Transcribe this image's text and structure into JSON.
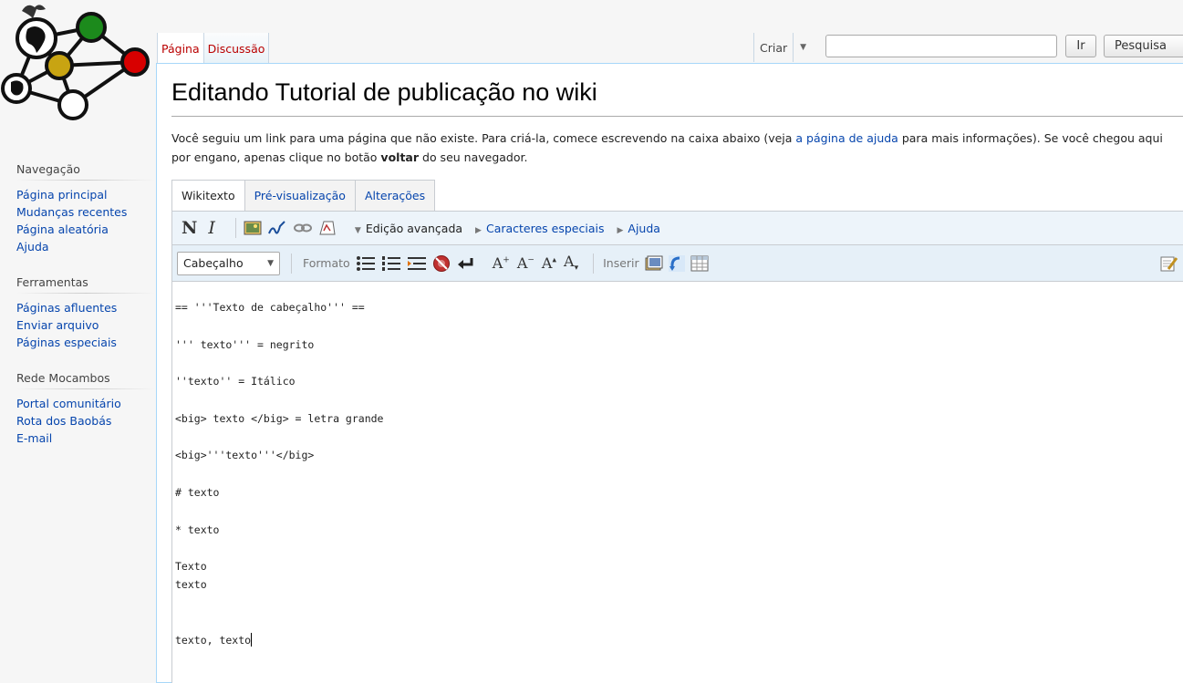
{
  "nav_tabs": {
    "page": "Página",
    "discussion": "Discussão",
    "create": "Criar"
  },
  "search": {
    "value": "",
    "go_label": "Ir",
    "search_label": "Pesquisa"
  },
  "sidebar": {
    "sections": [
      {
        "title": "Navegação",
        "items": [
          "Página principal",
          "Mudanças recentes",
          "Página aleatória",
          "Ajuda"
        ]
      },
      {
        "title": "Ferramentas",
        "items": [
          "Páginas afluentes",
          "Enviar arquivo",
          "Páginas especiais"
        ]
      },
      {
        "title": "Rede Mocambos",
        "items": [
          "Portal comunitário",
          "Rota dos Baobás",
          "E-mail"
        ]
      }
    ]
  },
  "page": {
    "title": "Editando Tutorial de publicação no wiki",
    "intro_part1": "Você seguiu um link para uma página que não existe. Para criá-la, comece escrevendo na caixa abaixo (veja ",
    "intro_link": "a página de ajuda",
    "intro_part2": " para mais informações). Se você chegou aqui por engano, apenas clique no botão ",
    "intro_bold": "voltar",
    "intro_part3": " do seu navegador."
  },
  "editor": {
    "tabs": [
      "Wikitexto",
      "Pré-visualização",
      "Alterações"
    ],
    "toolbar": {
      "bold": "N",
      "italic": "I",
      "advanced": "Edição avançada",
      "special_chars": "Caracteres especiais",
      "help": "Ajuda",
      "heading_select": "Cabeçalho",
      "format_label": "Formato",
      "insert_label": "Inserir",
      "big": "A",
      "small": "A",
      "sup": "A",
      "sub": "A"
    },
    "lines": [
      "== '''Texto de cabeçalho''' ==",
      "",
      "''' texto''' = negrito",
      "",
      "''texto'' = Itálico",
      "",
      "<big> texto </big> = letra grande",
      "",
      "<big>'''texto'''</big>",
      "",
      "# texto",
      "",
      "* texto",
      "",
      "Texto",
      "texto",
      "",
      "",
      "texto, texto"
    ]
  },
  "colors": {
    "link": "#0645ad",
    "new_link": "#ba0000",
    "toolbar_bg": "#edf4fa",
    "border": "#a7d7f9"
  }
}
